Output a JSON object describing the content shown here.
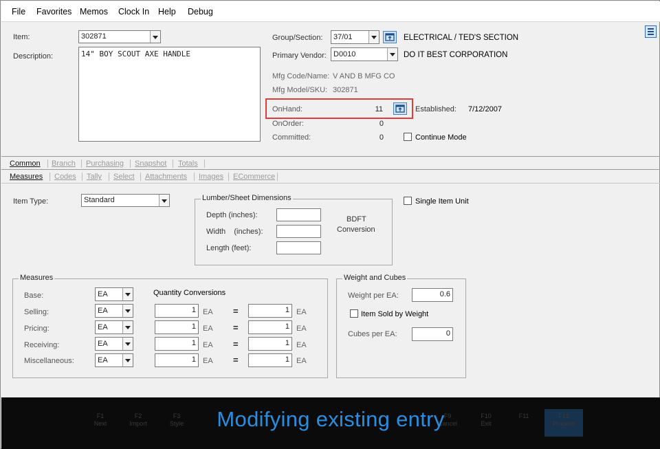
{
  "menu": [
    "File",
    "Favorites",
    "Memos",
    "Clock In",
    "Help",
    "Debug"
  ],
  "item": {
    "item_label": "Item:",
    "item_value": "302871",
    "description_label": "Description:",
    "description_value": "14\" BOY SCOUT AXE HANDLE",
    "group_label": "Group/Section:",
    "group_value": "37/01",
    "group_name": "ELECTRICAL / TED'S SECTION",
    "vendor_label": "Primary Vendor:",
    "vendor_value": "D0010",
    "vendor_name": "DO IT BEST CORPORATION",
    "mfg_code_label": "Mfg Code/Name:",
    "mfg_code_value": "V AND B MFG CO",
    "mfg_model_label": "Mfg Model/SKU:",
    "mfg_model_value": "302871",
    "onhand_label": "OnHand:",
    "onhand_value": "11",
    "onorder_label": "OnOrder:",
    "onorder_value": "0",
    "committed_label": "Committed:",
    "committed_value": "0",
    "established_label": "Established:",
    "established_value": "7/12/2007",
    "continue_mode_label": "Continue Mode"
  },
  "tabs_primary": [
    "Common",
    "Branch",
    "Purchasing",
    "Snapshot",
    "Totals"
  ],
  "tabs_secondary": [
    "Measures",
    "Codes",
    "Tally",
    "Select",
    "Attachments",
    "Images",
    "ECommerce"
  ],
  "measures_tab": {
    "item_type_label": "Item Type:",
    "item_type_value": "Standard",
    "single_item_unit_label": "Single Item Unit",
    "lumber": {
      "title": "Lumber/Sheet Dimensions",
      "depth_label": "Depth (inches):",
      "width_label": "Width    (inches):",
      "length_label": "Length (feet):",
      "bdft_line1": "BDFT",
      "bdft_line2": "Conversion"
    },
    "measures": {
      "title": "Measures",
      "quantity_conversions": "Quantity Conversions",
      "equals": "=",
      "rows": [
        {
          "label": "Base:",
          "uom": "EA"
        },
        {
          "label": "Selling:",
          "uom": "EA",
          "qty_left": "1",
          "unit_left": "EA",
          "qty_right": "1",
          "unit_right": "EA"
        },
        {
          "label": "Pricing:",
          "uom": "EA",
          "qty_left": "1",
          "unit_left": "EA",
          "qty_right": "1",
          "unit_right": "EA"
        },
        {
          "label": "Receiving:",
          "uom": "EA",
          "qty_left": "1",
          "unit_left": "EA",
          "qty_right": "1",
          "unit_right": "EA"
        },
        {
          "label": "Miscellaneous:",
          "uom": "EA",
          "qty_left": "1",
          "unit_left": "EA",
          "qty_right": "1",
          "unit_right": "EA"
        }
      ]
    },
    "weight": {
      "title": "Weight and Cubes",
      "weight_label": "Weight per EA:",
      "weight_value": "0.6",
      "sold_by_weight_label": "Item Sold by Weight",
      "cubes_label": "Cubes per EA:",
      "cubes_value": "0"
    }
  },
  "footer": {
    "caption": "Modifying existing entry",
    "keys": [
      {
        "key": "F1",
        "label": "Next"
      },
      {
        "key": "F2",
        "label": "Import"
      },
      {
        "key": "F3",
        "label": "Style"
      },
      {
        "key": "F9",
        "label": "Cancel"
      },
      {
        "key": "F10",
        "label": "Exit"
      },
      {
        "key": "F11",
        "label": ""
      },
      {
        "key": "F12",
        "label": "Process"
      }
    ]
  },
  "colors": {
    "highlight_box": "#e03c3c",
    "caption": "#2a8ee0",
    "picker_button": "#cfe3f7"
  }
}
